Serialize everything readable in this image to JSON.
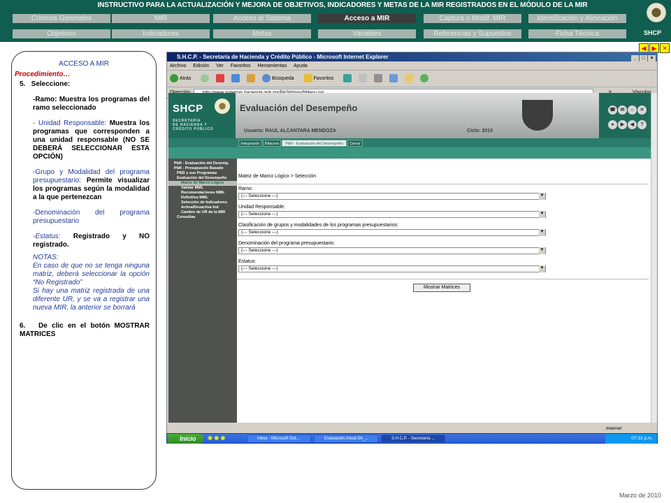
{
  "header": {
    "title": "INSTRUCTIVO PARA  LA ACTUALIZACIÓN Y MEJORA DE OBJETIVOS, INDICADORES Y METAS DE LA MIR REGISTRADOS EN EL MÓDULO DE LA MIR",
    "logo_label": "SHCP",
    "tabs_row1": [
      "Criterios Generales",
      "MIR",
      "Acceso al Sistema",
      "Acceso a MIR",
      "Captura o Modif. MIR",
      "Identificación y Alineación"
    ],
    "tabs_row2": [
      "Objetivos",
      "Indicadores",
      "Metas",
      "Variables",
      "Referencias y Supuestos",
      "Ficha Técnica"
    ],
    "active_tab": "Acceso a MIR",
    "nav_arrows": [
      "◀",
      "▶",
      "✕"
    ]
  },
  "panel": {
    "title": "ACCESO A MIR",
    "subtitle": "Procedimiento…",
    "step5": "5.   Seleccione:",
    "ramo": "-Ramo: Muestra los programas del ramo seleccionado",
    "ur_label": "- Unidad Responsable:",
    "ur_text": "Muestra los programas que corresponden a una unidad responsable (NO SE DEBERÁ SELECCIONAR ESTA OPCIÓN)",
    "grupo_label": "-Grupo y Modalidad del programa presupuestario:",
    "grupo_text": "Permite visualizar los programas según la modalidad a la que pertenezcan",
    "denominacion": "-Denominación del programa presupuestario",
    "estatus_label": "-Estatus:",
    "estatus_text": "Registrado y NO registrado.",
    "notas_label": "NOTAS:",
    "nota1": "En caso de que no se tenga ninguna matriz, deberá seleccionar la opción “No Registrado”",
    "nota2": "Si hay una matriz registrada de una diferente UR, y se va a registrar una nueva MIR, la anterior se borrará",
    "step6": "6.   De clic en el botón MOSTRAR MATRICES"
  },
  "footer_date": "Marzo de 2010",
  "browser": {
    "title": "S.H.C.P. - Secretaría de Hacienda y Crédito Público - Microsoft Internet Explorer",
    "win_buttons": [
      "_",
      "□",
      "×"
    ],
    "menu": [
      "Archivo",
      "Edición",
      "Ver",
      "Favoritos",
      "Herramientas",
      "Ayuda"
    ],
    "toolbar": {
      "back": "Atrás",
      "search": "Búsqueda",
      "favorites": "Favoritos"
    },
    "address_label": "Dirección",
    "address": "http://www.sistemas.hacienda.gob.mx/PASH/jsps/frMenu.jsp",
    "go": "Ir",
    "links": "Vínculos",
    "status": "Internet"
  },
  "app": {
    "logo": "SHCP",
    "agency": [
      "SECRETARÍA",
      "DE HACIENDA Y",
      "CRÉDITO PÚBLICO"
    ],
    "heading": "Evaluación del Desempeño",
    "user": "Usuario: RAUL ALCANTARA MENDOZA",
    "cycle": "Ciclo: 2010",
    "tabs": [
      "Integración",
      "Bitácora",
      "PbR - Evaluación del Desempeño",
      "Cerrar"
    ],
    "nav": [
      "PbR - Evaluación del Desemp.",
      "PbR - Presupuesto Basado",
      "PND y sus Programas",
      "Evaluación del Desempeño",
      "Matriz de Marco Lógico",
      "Validar MML",
      "Recomendaciones MML",
      "Definitiva MML",
      "Selección de Indicadores",
      "Activa/Desactiva Ind.",
      "Cambio de UR de la MIR",
      "Consultas"
    ],
    "breadcrumb": "Matriz de Marco Lógico > Selección",
    "fields": [
      {
        "label": "Ramo:",
        "value": "(--- Seleccione ---)"
      },
      {
        "label": "Unidad Responsable:",
        "value": "(--- Seleccione ---)"
      },
      {
        "label": "Clasificación de grupos y modalidades de los programas presupuestarios:",
        "value": "(--- Seleccione ---)"
      },
      {
        "label": "Denominación del programa presupuestario:",
        "value": "(--- Seleccione ---)"
      },
      {
        "label": "Estatus:",
        "value": "(--- Seleccione ---)"
      }
    ],
    "button": "Mostrar Matrices"
  },
  "taskbar": {
    "start": "Inicio",
    "items": [
      "Inbox - Microsoft Out...",
      "Evaluación Anual 5A_...",
      "S.H.C.P. - Secretaría ..."
    ],
    "time": "07:13 p.m."
  },
  "colors": {
    "header_green": "#0f5e4f",
    "active_tab": "#3c3c3c",
    "accent_blue": "#1e3a99",
    "accent_red": "#c00000"
  }
}
